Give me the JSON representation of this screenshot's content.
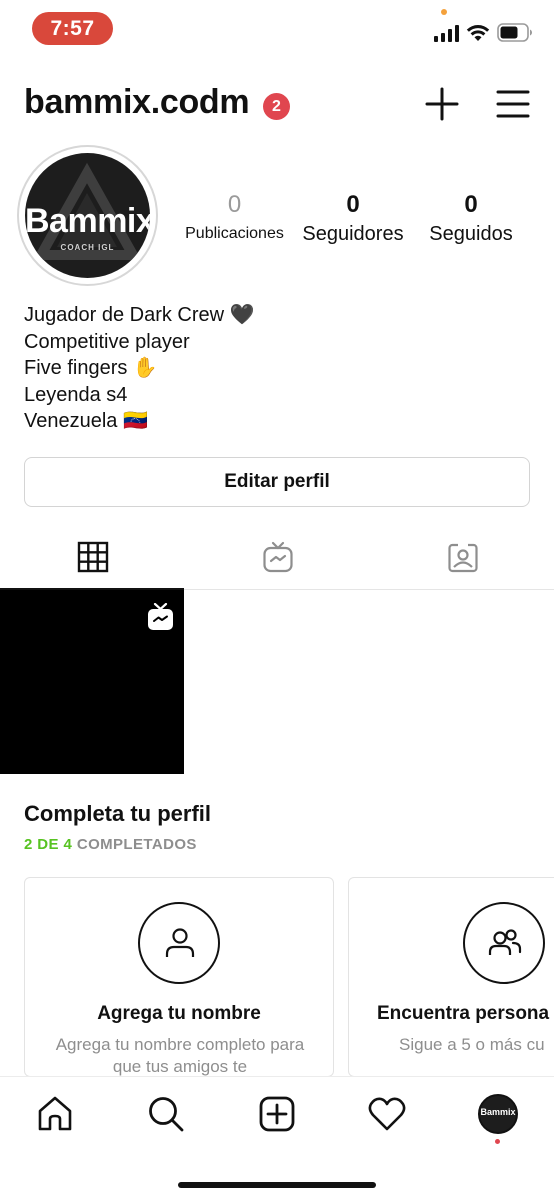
{
  "status_bar": {
    "time": "7:57"
  },
  "header": {
    "username": "bammix.codm",
    "notification_count": "2",
    "plus_icon": "plus-icon",
    "menu_icon": "hamburger-menu-icon"
  },
  "profile": {
    "avatar_text": "Bammix",
    "avatar_subtext": "COACH IGL",
    "stats": [
      {
        "value": "0",
        "label": "Publicaciones"
      },
      {
        "value": "0",
        "label": "Seguidores"
      },
      {
        "value": "0",
        "label": "Seguidos"
      }
    ],
    "bio": [
      "Jugador de Dark Crew 🖤",
      "Competitive player",
      "Five fingers ✋",
      "Leyenda s4",
      "Venezuela 🇻🇪"
    ],
    "edit_button": "Editar perfil"
  },
  "tabs": [
    {
      "icon": "grid-icon",
      "active": true
    },
    {
      "icon": "igtv-icon",
      "active": false
    },
    {
      "icon": "tagged-icon",
      "active": false
    }
  ],
  "complete_profile": {
    "title": "Completa tu perfil",
    "progress_done": "2 DE 4",
    "progress_label": " COMPLETADOS",
    "cards": [
      {
        "icon": "person-icon",
        "title": "Agrega tu nombre",
        "description": "Agrega tu nombre completo para que tus amigos te"
      },
      {
        "icon": "people-icon",
        "title": "Encuentra persona",
        "description": "Sigue a 5 o más cu"
      }
    ]
  },
  "bottom_nav": {
    "items": [
      "home-icon",
      "search-icon",
      "create-icon",
      "heart-icon",
      "profile-avatar"
    ],
    "profile_avatar_text": "Bammix"
  },
  "colors": {
    "time_pill": "#d9483b",
    "badge": "#e0464f",
    "progress_green": "#58c322",
    "muted_text": "#8e8e8e"
  }
}
